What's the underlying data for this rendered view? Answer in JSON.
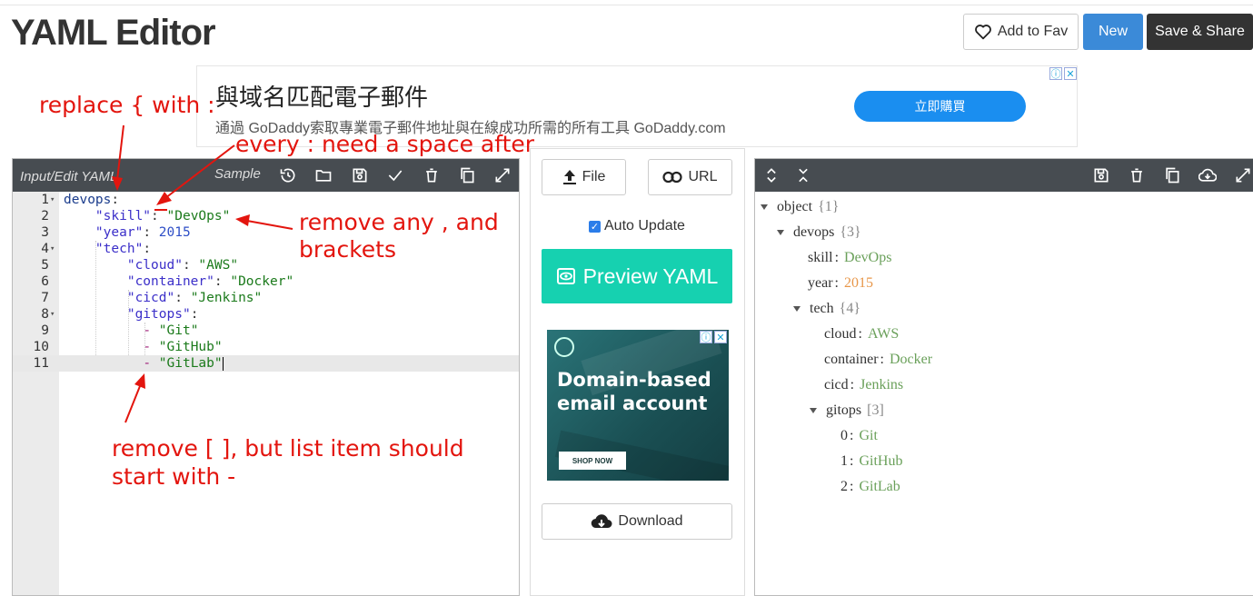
{
  "header": {
    "title": "YAML Editor",
    "add_fav": "Add to Fav",
    "new": "New",
    "save_share": "Save & Share"
  },
  "ad_top": {
    "headline": "與域名匹配電子郵件",
    "description": "通過 GoDaddy索取專業電子郵件地址與在線成功所需的所有工具 GoDaddy.com",
    "cta": "立即購買"
  },
  "editor": {
    "title": "Input/Edit YAML",
    "sample": "Sample",
    "lines": [
      {
        "num": "1",
        "fold": true
      },
      {
        "num": "2",
        "fold": false
      },
      {
        "num": "3",
        "fold": false
      },
      {
        "num": "4",
        "fold": true
      },
      {
        "num": "5",
        "fold": false
      },
      {
        "num": "6",
        "fold": false
      },
      {
        "num": "7",
        "fold": false
      },
      {
        "num": "8",
        "fold": true
      },
      {
        "num": "9",
        "fold": false
      },
      {
        "num": "10",
        "fold": false
      },
      {
        "num": "11",
        "fold": false
      }
    ],
    "code": {
      "l1_key": "devops",
      "l2_key": "\"skill\"",
      "l2_val": "\"DevOps\"",
      "l3_key": "\"year\"",
      "l3_val": "2015",
      "l4_key": "\"tech\"",
      "l5_key": "\"cloud\"",
      "l5_val": "\"AWS\"",
      "l6_key": "\"container\"",
      "l6_val": "\"Docker\"",
      "l7_key": "\"cicd\"",
      "l7_val": "\"Jenkins\"",
      "l8_key": "\"gitops\"",
      "l9_val": "\"Git\"",
      "l10_val": "\"GitHub\"",
      "l11_val": "\"GitLab\""
    }
  },
  "middle": {
    "file": "File",
    "url": "URL",
    "auto_update": "Auto Update",
    "auto_update_checked": true,
    "preview": "Preview YAML",
    "ad_headline": "Domain-based email account",
    "ad_shop": "SHOP NOW",
    "download": "Download"
  },
  "tree": {
    "root": {
      "key": "object",
      "count": "{1}"
    },
    "devops": {
      "key": "devops",
      "count": "{3}"
    },
    "skill": {
      "key": "skill",
      "val": "DevOps"
    },
    "year": {
      "key": "year",
      "val": "2015"
    },
    "tech": {
      "key": "tech",
      "count": "{4}"
    },
    "cloud": {
      "key": "cloud",
      "val": "AWS"
    },
    "container": {
      "key": "container",
      "val": "Docker"
    },
    "cicd": {
      "key": "cicd",
      "val": "Jenkins"
    },
    "gitops": {
      "key": "gitops",
      "count": "[3]"
    },
    "items": [
      {
        "key": "0",
        "val": "Git"
      },
      {
        "key": "1",
        "val": "GitHub"
      },
      {
        "key": "2",
        "val": "GitLab"
      }
    ]
  },
  "annotations": {
    "replace": "replace { with :",
    "space": "every : need a space after",
    "remove_comma_1": "remove any , and",
    "remove_comma_2": "brackets",
    "remove_list_1": "remove [ ], but list item should",
    "remove_list_2": "start with -"
  },
  "colors": {
    "panel_bar": "#474c51",
    "preview": "#16d1b0",
    "new_button": "#3b8ad8",
    "annotation": "#e3150e"
  }
}
